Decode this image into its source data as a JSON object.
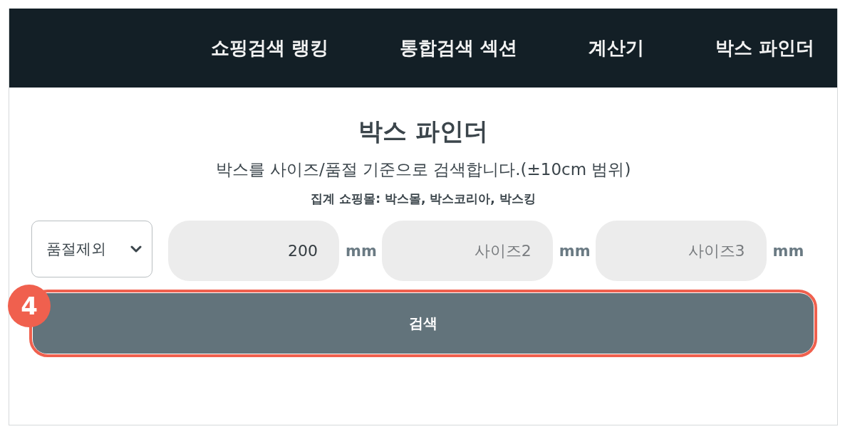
{
  "nav": {
    "items": [
      {
        "label": "쇼핑검색 랭킹"
      },
      {
        "label": "통합검색 섹션"
      },
      {
        "label": "계산기"
      },
      {
        "label": "박스 파인더"
      }
    ]
  },
  "header": {
    "title": "박스 파인더",
    "description": "박스를 사이즈/품절 기준으로 검색합니다.(±10cm 범위)",
    "sources": "집계 쇼핑몰: 박스몰, 박스코리아, 박스킹"
  },
  "filters": {
    "stock_select": {
      "value": "품절제외"
    },
    "sizes": [
      {
        "value": "200",
        "unit": "mm"
      },
      {
        "placeholder": "사이즈2",
        "unit": "mm"
      },
      {
        "placeholder": "사이즈3",
        "unit": "mm"
      }
    ]
  },
  "search_button": {
    "label": "검색",
    "highlighted": true
  },
  "callout": {
    "number": "4"
  }
}
